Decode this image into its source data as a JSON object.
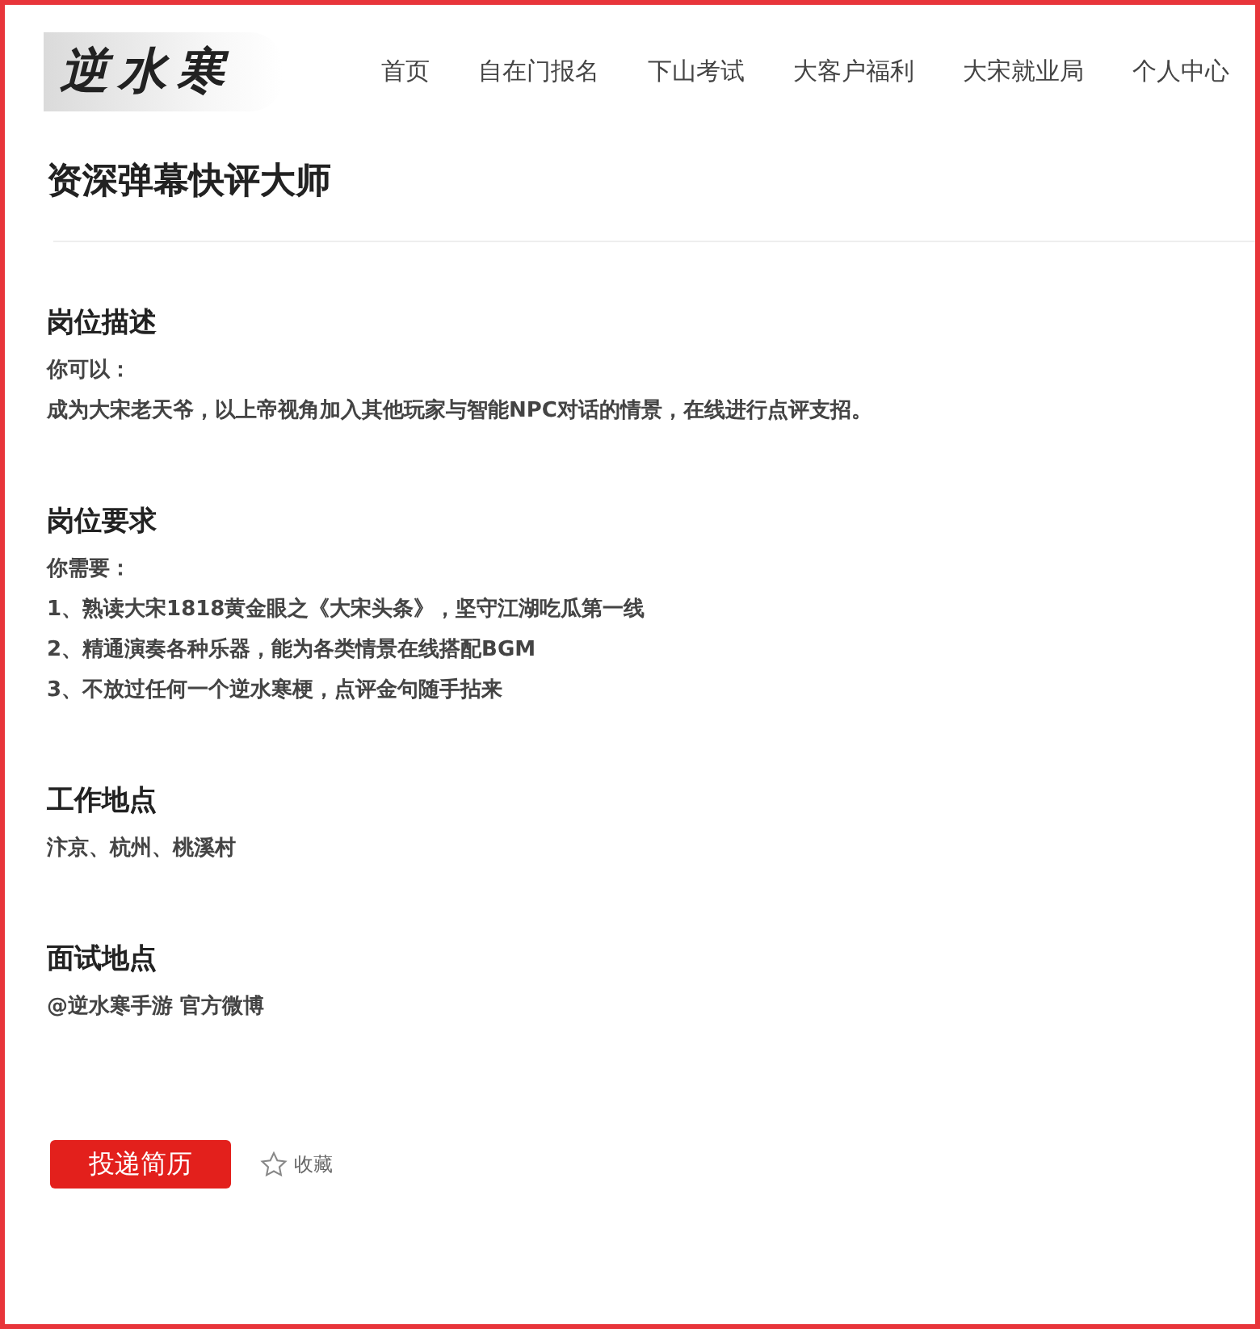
{
  "logo": "逆水寒",
  "nav": [
    "首页",
    "自在门报名",
    "下山考试",
    "大客户福利",
    "大宋就业局",
    "个人中心"
  ],
  "title": "资深弹幕快评大师",
  "sections": [
    {
      "heading": "岗位描述",
      "lines": [
        "你可以：",
        "成为大宋老天爷，以上帝视角加入其他玩家与智能NPC对话的情景，在线进行点评支招。"
      ]
    },
    {
      "heading": "岗位要求",
      "lines": [
        "你需要：",
        "1、熟读大宋1818黄金眼之《大宋头条》，坚守江湖吃瓜第一线",
        "2、精通演奏各种乐器，能为各类情景在线搭配BGM",
        "3、不放过任何一个逆水寒梗，点评金句随手拈来"
      ]
    },
    {
      "heading": "工作地点",
      "lines": [
        "汴京、杭州、桃溪村"
      ]
    },
    {
      "heading": "面试地点",
      "lines": [
        "@逆水寒手游 官方微博"
      ]
    }
  ],
  "apply_button": "投递简历",
  "favorite": {
    "label": "收藏",
    "selected": false
  }
}
